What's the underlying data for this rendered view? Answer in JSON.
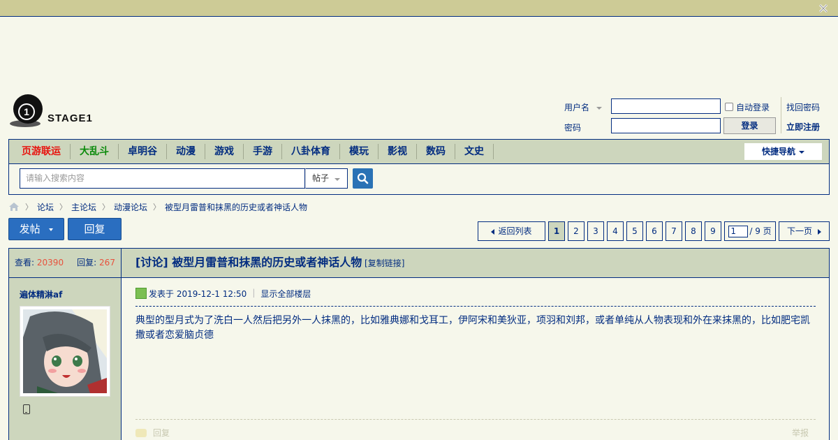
{
  "logo": {
    "text": "STAGE1",
    "icon": "stage1-logo-icon"
  },
  "login": {
    "username_label": "用户名",
    "password_label": "密码",
    "auto_login": "自动登录",
    "login_button": "登录",
    "forgot_password": "找回密码",
    "register": "立即注册"
  },
  "nav": {
    "items": [
      {
        "label": "页游联运",
        "color": "#e8130e"
      },
      {
        "label": "大乱斗",
        "color": "#0a8a0a"
      },
      {
        "label": "卓明谷"
      },
      {
        "label": "动漫"
      },
      {
        "label": "游戏"
      },
      {
        "label": "手游"
      },
      {
        "label": "八卦体育"
      },
      {
        "label": "模玩"
      },
      {
        "label": "影视"
      },
      {
        "label": "数码"
      },
      {
        "label": "文史"
      }
    ],
    "quick_nav": "快捷导航"
  },
  "search": {
    "placeholder": "请输入搜索内容",
    "type": "帖子"
  },
  "breadcrumb": {
    "items": [
      "论坛",
      "主论坛",
      "动漫论坛",
      "被型月雷普和抹黑的历史或者神话人物"
    ]
  },
  "toolbar": {
    "new_post": "发帖",
    "reply": "回复"
  },
  "pager": {
    "back": "返回列表",
    "pages": [
      "1",
      "2",
      "3",
      "4",
      "5",
      "6",
      "7",
      "8",
      "9"
    ],
    "current": "1",
    "jump_value": "1",
    "total": "/ 9 页",
    "next": "下一页"
  },
  "thread": {
    "views_label": "查看:",
    "views": "20390",
    "replies_label": "回复:",
    "replies": "267",
    "title": "[讨论] 被型月雷普和抹黑的历史或者神话人物",
    "copy_link": "[复制链接]"
  },
  "post": {
    "author": "遍体精淋af",
    "posted_at": "发表于 2019-12-1 12:50",
    "show_all": "显示全部楼层",
    "content": "典型的型月式为了洗白一人然后把另外一人抹黑的，比如雅典娜和戈耳工，伊阿宋和美狄亚，项羽和刘邦，或者单纯从人物表现和外在来抹黑的，比如肥宅凯撒或者恋爱脑贞德",
    "reply": "回复",
    "report": "举报"
  }
}
